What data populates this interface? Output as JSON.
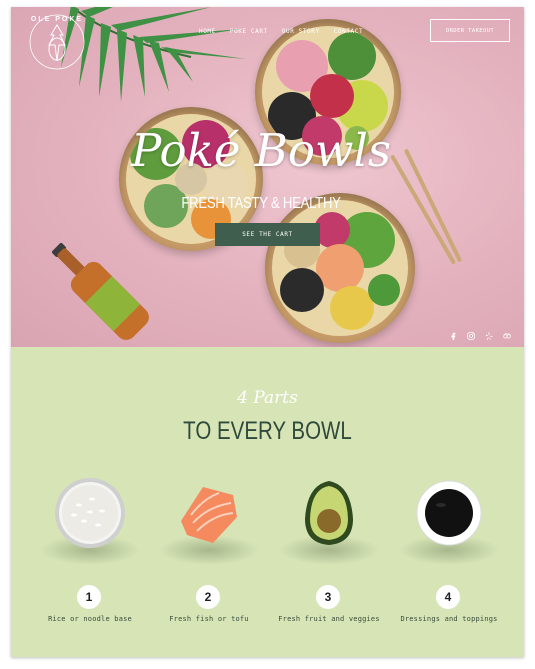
{
  "brand": {
    "logo_text": "OLE POKE"
  },
  "nav": {
    "items": [
      "HOME",
      "POKE CART",
      "OUR STORY",
      "CONTACT"
    ],
    "order_button": "ORDER TAKEOUT"
  },
  "hero": {
    "title": "Poké Bowls",
    "subtitle": "FRESH TASTY & HEALTHY",
    "cta": "SEE THE CART",
    "social_icons": [
      "facebook-icon",
      "instagram-icon",
      "yelp-icon",
      "tripadvisor-icon"
    ]
  },
  "parts": {
    "script": "4 Parts",
    "title": "TO EVERY BOWL",
    "items": [
      {
        "number": "1",
        "caption": "Rice or noodle base",
        "icon": "rice-bowl"
      },
      {
        "number": "2",
        "caption": "Fresh fish or tofu",
        "icon": "salmon"
      },
      {
        "number": "3",
        "caption": "Fresh fruit and veggies",
        "icon": "avocado"
      },
      {
        "number": "4",
        "caption": "Dressings and toppings",
        "icon": "soy-sauce"
      }
    ]
  },
  "colors": {
    "hero_bg": "#e6b8c4",
    "section_bg": "#d6e4b6",
    "cta_bg": "#3f5e4d",
    "title_green": "#2f4a3c"
  }
}
